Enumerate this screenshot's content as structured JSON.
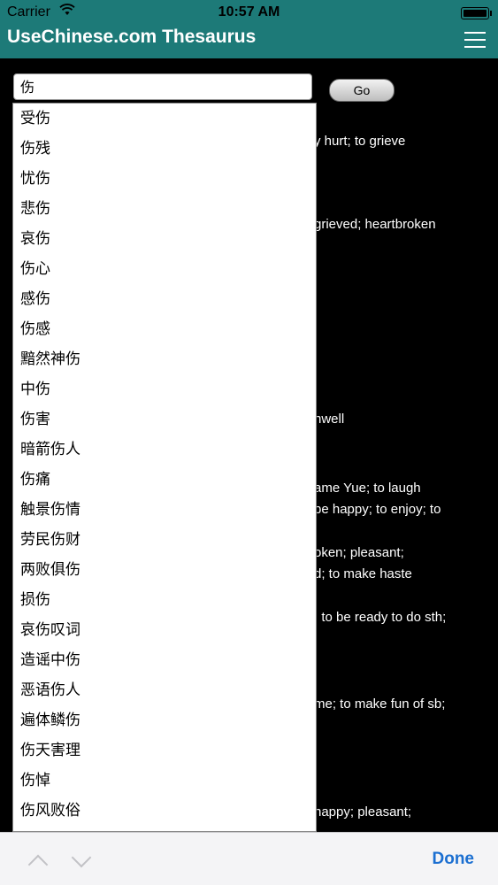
{
  "status_bar": {
    "carrier": "Carrier",
    "time": "10:57 AM"
  },
  "app_bar": {
    "title": "UseChinese.com Thesaurus"
  },
  "search": {
    "value": "伤",
    "go_label": "Go"
  },
  "background_results": [
    "y hurt; to grieve",
    "grieved; heartbroken",
    "nwell",
    "ame Yue; to laugh",
    "be happy; to enjoy; to",
    "oken; pleasant;",
    "d; to make haste",
    "; to be ready to do sth;",
    "me; to make fun of sb;",
    "happy; pleasant;"
  ],
  "suggestions": [
    "受伤",
    "伤残",
    "忧伤",
    "悲伤",
    "哀伤",
    "伤心",
    "感伤",
    "伤感",
    "黯然神伤",
    "中伤",
    "伤害",
    "暗箭伤人",
    "伤痛",
    "触景伤情",
    "劳民伤财",
    "两败俱伤",
    "损伤",
    "哀伤叹词",
    "造谣中伤",
    "恶语伤人",
    "遍体鳞伤",
    "伤天害理",
    "伤悼",
    "伤风败俗"
  ],
  "keyboard_toolbar": {
    "done_label": "Done"
  }
}
